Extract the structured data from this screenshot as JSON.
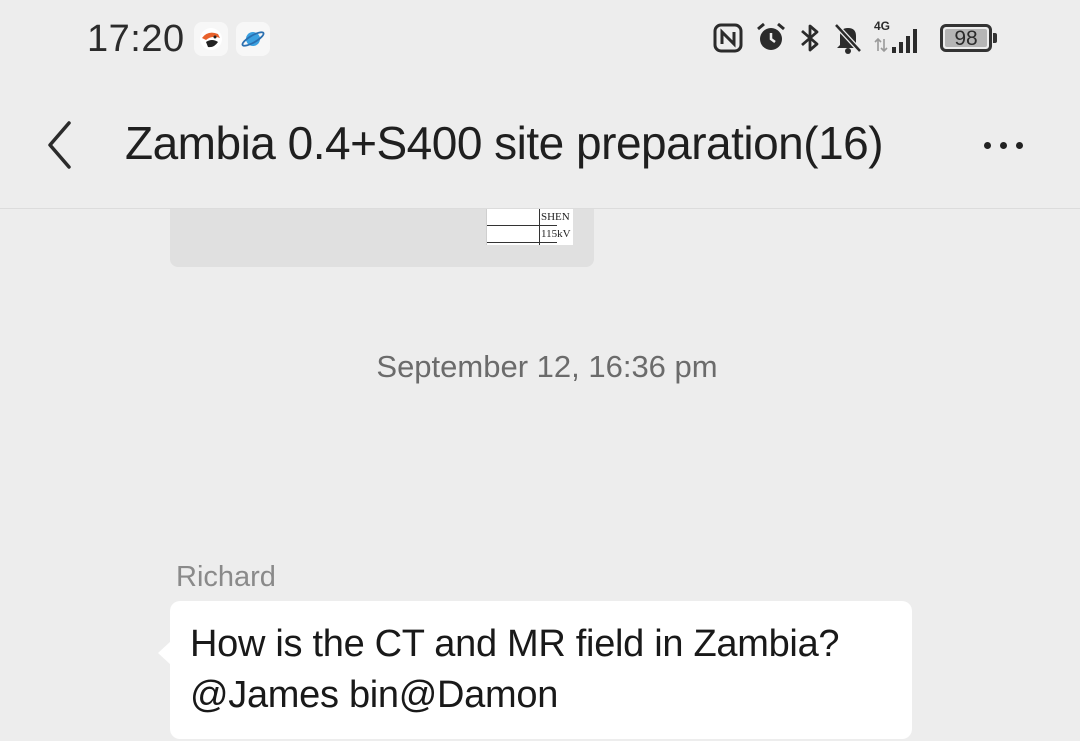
{
  "status_bar": {
    "time": "17:20",
    "app_icons": [
      "app-notification-icon-1",
      "app-notification-icon-2"
    ],
    "icons": [
      "nfc-icon",
      "alarm-icon",
      "bluetooth-icon",
      "mute-bell-icon",
      "signal-icon",
      "battery-icon"
    ],
    "network_label": "4G",
    "battery_level": "98"
  },
  "header": {
    "back_icon": "chevron-left-icon",
    "title": "Zambia 0.4+S400 site preparation(16)",
    "more_icon": "more-dots-icon"
  },
  "chat": {
    "attachment": {
      "preview_rows": [
        "SHEN",
        "115kV"
      ]
    },
    "timestamp": "September 12, 16:36 pm",
    "message": {
      "sender": "Richard",
      "text": "How is the CT and MR field in Zambia?\n@James bin@Damon"
    }
  }
}
